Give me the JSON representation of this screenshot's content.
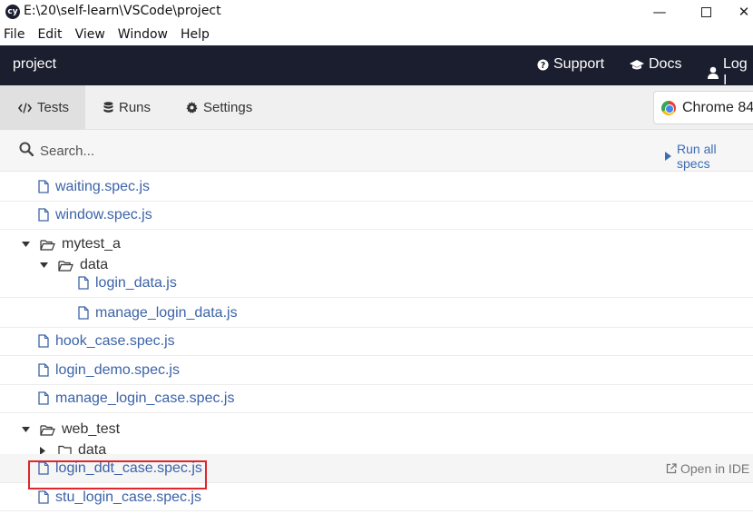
{
  "window": {
    "logo_text": "cy",
    "title": "E:\\20\\self-learn\\VSCode\\project",
    "minimize_glyph": "—",
    "close_glyph": "✕"
  },
  "menu": {
    "items": [
      "File",
      "Edit",
      "View",
      "Window",
      "Help"
    ]
  },
  "header": {
    "project_name": "project",
    "links": {
      "support": "Support",
      "docs": "Docs",
      "login": "Log I"
    },
    "icons": {
      "support": "question-circle-icon",
      "docs": "graduation-cap-icon",
      "login": "user-icon"
    }
  },
  "tabs": {
    "tests": "Tests",
    "runs": "Runs",
    "settings": "Settings",
    "active": "tests"
  },
  "browser": {
    "label": "Chrome 84",
    "icon": "chrome-icon"
  },
  "search": {
    "placeholder": "Search...",
    "value": ""
  },
  "run_all": {
    "label": "Run all specs"
  },
  "specs": [
    {
      "type": "file",
      "name": "waiting.spec.js",
      "depth": 0
    },
    {
      "type": "file",
      "name": "window.spec.js",
      "depth": 0
    },
    {
      "type": "folder",
      "name": "mytest_a",
      "depth": 0,
      "expanded": true
    },
    {
      "type": "folder",
      "name": "data",
      "depth": 1,
      "expanded": true
    },
    {
      "type": "file",
      "name": "login_data.js",
      "depth": 2
    },
    {
      "type": "file",
      "name": "manage_login_data.js",
      "depth": 2
    },
    {
      "type": "file",
      "name": "hook_case.spec.js",
      "depth": 0
    },
    {
      "type": "file",
      "name": "login_demo.spec.js",
      "depth": 0
    },
    {
      "type": "file",
      "name": "manage_login_case.spec.js",
      "depth": 0
    },
    {
      "type": "folder",
      "name": "web_test",
      "depth": 0,
      "expanded": true
    },
    {
      "type": "folder",
      "name": "data",
      "depth": 1,
      "expanded": false
    },
    {
      "type": "file",
      "name": "login_ddt_case.spec.js",
      "depth": 0,
      "hovered": true,
      "highlighted": true
    },
    {
      "type": "file",
      "name": "stu_login_case.spec.js",
      "depth": 0
    }
  ],
  "open_in_ide": {
    "label": "Open in IDE"
  },
  "colors": {
    "header_bg": "#1b1e2e",
    "link": "#3c63a8",
    "highlight": "#e0262a"
  }
}
